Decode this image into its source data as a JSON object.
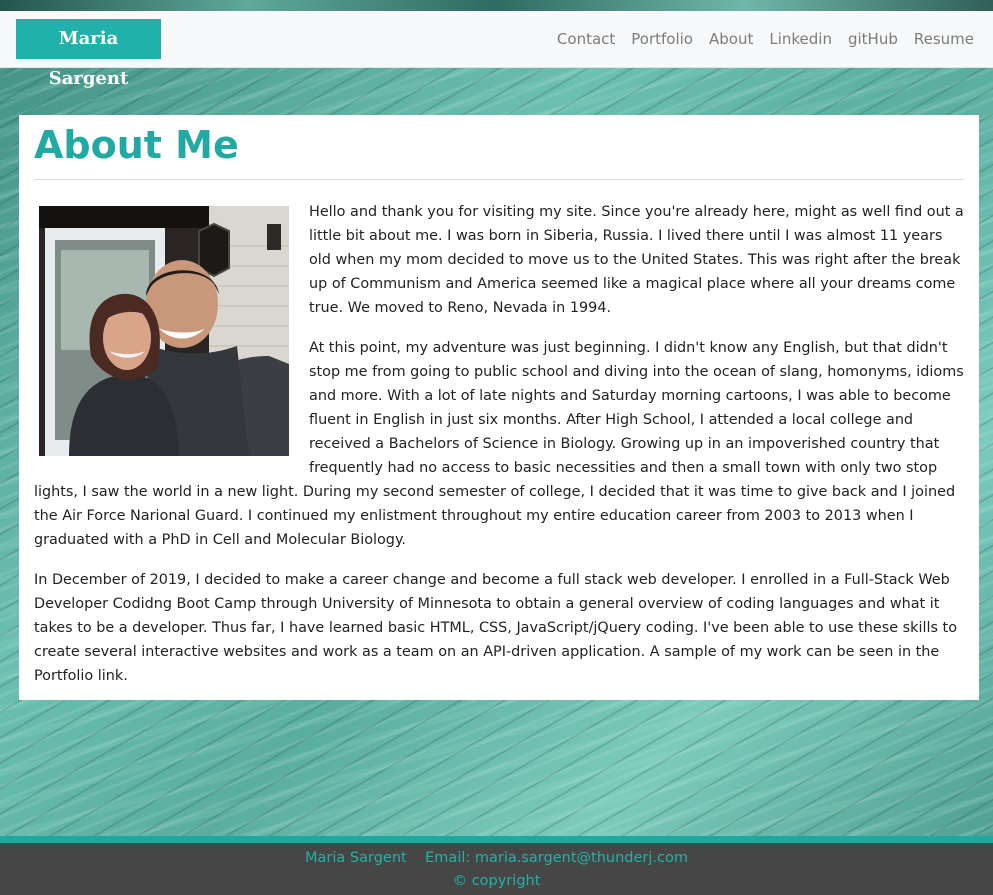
{
  "navbar": {
    "brand": "Maria Sargent",
    "links": [
      "Contact",
      "Portfolio",
      "About",
      "Linkedin",
      "gitHub",
      "Resume"
    ]
  },
  "main": {
    "title": "About Me",
    "paragraphs": [
      "Hello and thank you for visiting my site. Since you're already here, might as well find out a little bit about me. I was born in Siberia, Russia. I lived there until I was almost 11 years old when my mom decided to move us to the United States. This was right after the break up of Communism and America seemed like a magical place where all your dreams come true. We moved to Reno, Nevada in 1994.",
      "At this point, my adventure was just beginning. I didn't know any English, but that didn't stop me from going to public school and diving into the ocean of slang, homonyms, idioms and more. With a lot of late nights and Saturday morning cartoons, I was able to become fluent in English in just six months. After High School, I attended a local college and received a Bachelors of Science in Biology. Growing up in an impoverished country that frequently had no access to basic necessities and then a small town with only two stop lights, I saw the world in a new light. During my second semester of college, I decided that it was time to give back and I joined the Air Force Narional Guard. I continued my enlistment throughout my entire education career from 2003 to 2013 when I graduated with a PhD in Cell and Molecular Biology.",
      "In December of 2019, I decided to make a career change and become a full stack web developer. I enrolled in a Full-Stack Web Developer Codidng Boot Camp through University of Minnesota to obtain a general overview of coding languages and what it takes to be a developer. Thus far, I have learned basic HTML, CSS, JavaScript/jQuery coding. I've been able to use these skills to create several interactive websites and work as a team on an API-driven application. A sample of my work can be seen in the Portfolio link."
    ]
  },
  "footer": {
    "name": "Maria Sargent",
    "email_label": "Email:",
    "email": "maria.sargent@thunderj.com",
    "copyright": "© copyright"
  },
  "colors": {
    "accent": "#20b2aa",
    "navbar_bg": "#f8f9fa",
    "footer_bg": "#464646",
    "footer_text": "#1fb3a8"
  }
}
